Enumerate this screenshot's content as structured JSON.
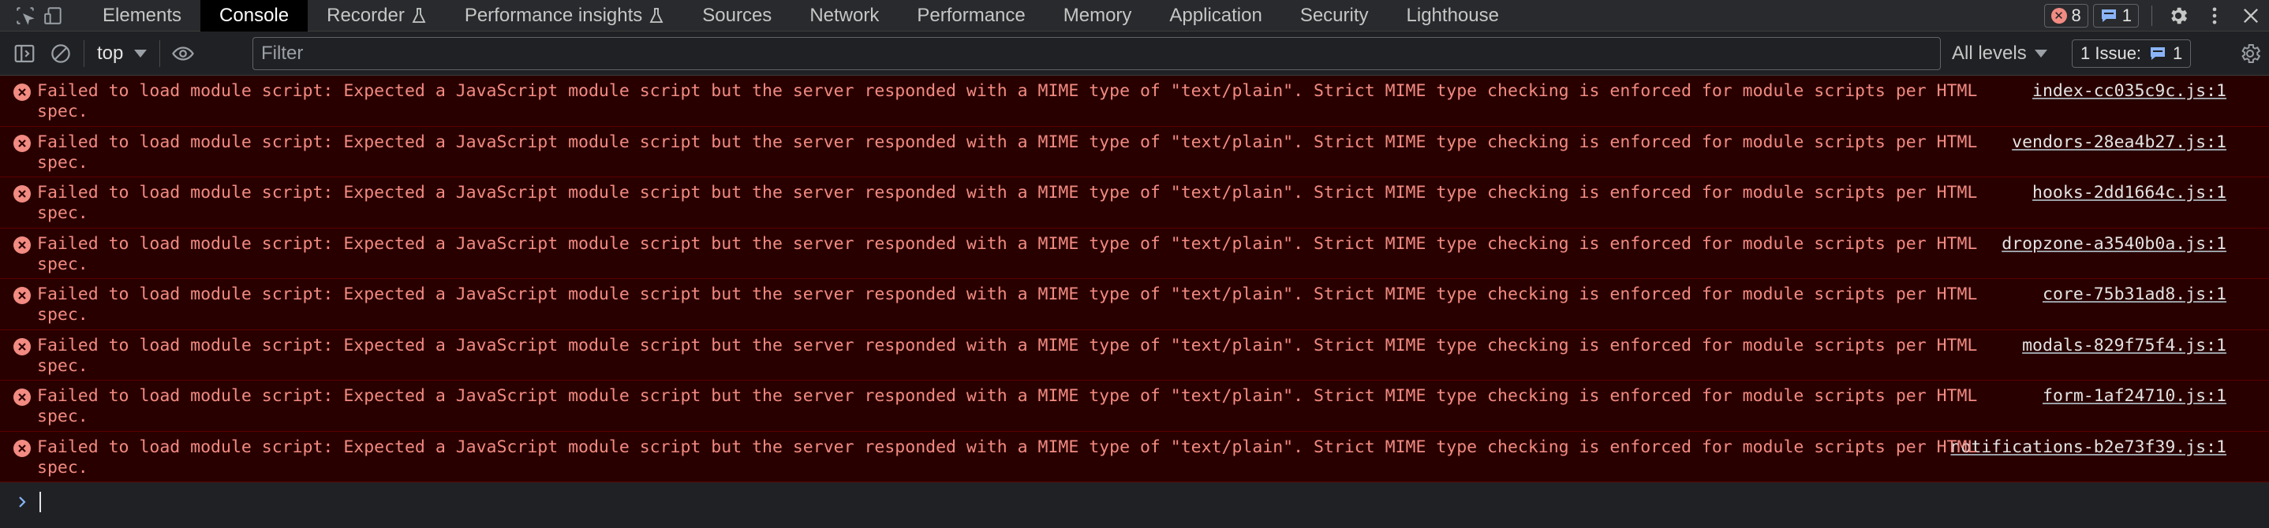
{
  "tabs": [
    {
      "label": "Elements",
      "active": false
    },
    {
      "label": "Console",
      "active": true
    },
    {
      "label": "Recorder",
      "active": false,
      "experimental": true
    },
    {
      "label": "Performance insights",
      "active": false,
      "experimental": true
    },
    {
      "label": "Sources",
      "active": false
    },
    {
      "label": "Network",
      "active": false
    },
    {
      "label": "Performance",
      "active": false
    },
    {
      "label": "Memory",
      "active": false
    },
    {
      "label": "Application",
      "active": false
    },
    {
      "label": "Security",
      "active": false
    },
    {
      "label": "Lighthouse",
      "active": false
    }
  ],
  "header": {
    "error_count": "8",
    "message_count": "1"
  },
  "toolbar": {
    "context": "top",
    "filter_placeholder": "Filter",
    "levels": "All levels",
    "issues_label": "1 Issue:",
    "issues_count": "1"
  },
  "messages": [
    {
      "text": "Failed to load module script: Expected a JavaScript module script but the server responded with a MIME type of \"text/plain\". Strict MIME type checking is enforced for module scripts per HTML spec.",
      "source": "index-cc035c9c.js:1"
    },
    {
      "text": "Failed to load module script: Expected a JavaScript module script but the server responded with a MIME type of \"text/plain\". Strict MIME type checking is enforced for module scripts per HTML spec.",
      "source": "vendors-28ea4b27.js:1"
    },
    {
      "text": "Failed to load module script: Expected a JavaScript module script but the server responded with a MIME type of \"text/plain\". Strict MIME type checking is enforced for module scripts per HTML spec.",
      "source": "hooks-2dd1664c.js:1"
    },
    {
      "text": "Failed to load module script: Expected a JavaScript module script but the server responded with a MIME type of \"text/plain\". Strict MIME type checking is enforced for module scripts per HTML spec.",
      "source": "dropzone-a3540b0a.js:1"
    },
    {
      "text": "Failed to load module script: Expected a JavaScript module script but the server responded with a MIME type of \"text/plain\". Strict MIME type checking is enforced for module scripts per HTML spec.",
      "source": "core-75b31ad8.js:1"
    },
    {
      "text": "Failed to load module script: Expected a JavaScript module script but the server responded with a MIME type of \"text/plain\". Strict MIME type checking is enforced for module scripts per HTML spec.",
      "source": "modals-829f75f4.js:1"
    },
    {
      "text": "Failed to load module script: Expected a JavaScript module script but the server responded with a MIME type of \"text/plain\". Strict MIME type checking is enforced for module scripts per HTML spec.",
      "source": "form-1af24710.js:1"
    },
    {
      "text": "Failed to load module script: Expected a JavaScript module script but the server responded with a MIME type of \"text/plain\". Strict MIME type checking is enforced for module scripts per HTML spec.",
      "source": "notifications-b2e73f39.js:1"
    }
  ],
  "colors": {
    "error_text": "#f28b82",
    "error_bg": "#290000",
    "error_border": "#5c0000",
    "panel_bg": "#202124",
    "accent": "#8ab4f8"
  }
}
